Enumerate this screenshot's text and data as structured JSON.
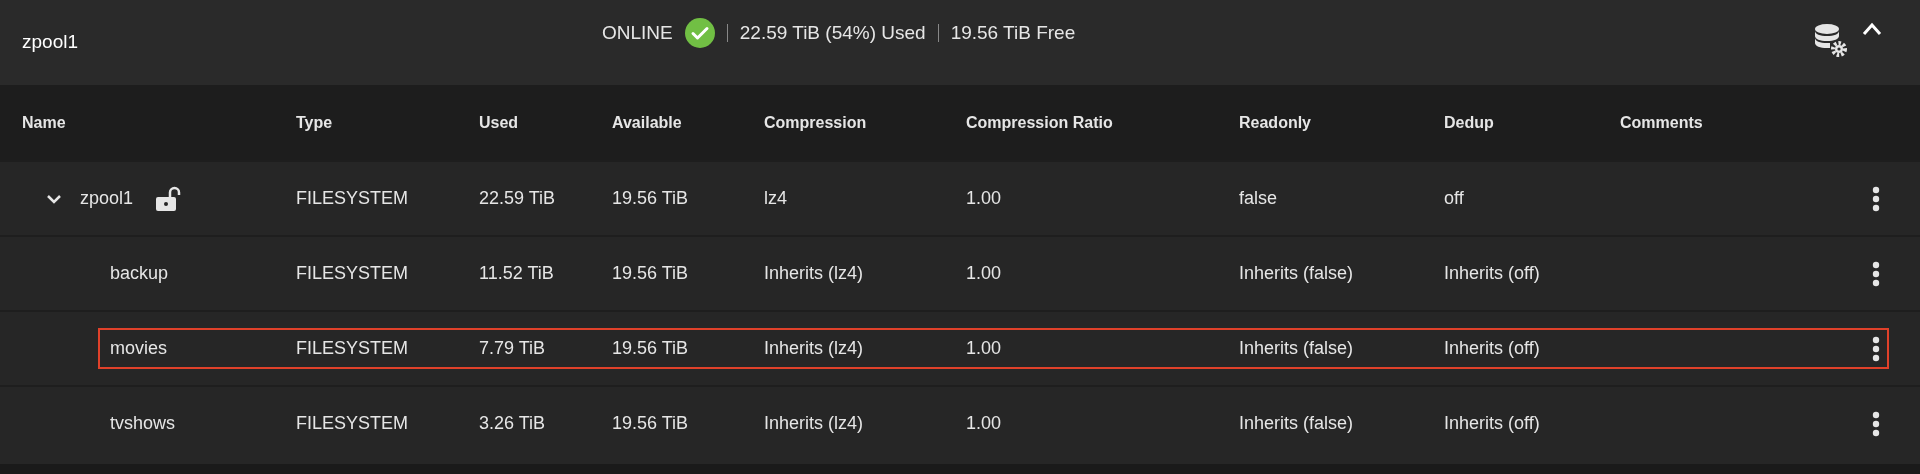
{
  "pool": {
    "name": "zpool1",
    "status": "ONLINE",
    "healthy": true,
    "used": "22.59 TiB (54%) Used",
    "free": "19.56 TiB Free",
    "expanded": true
  },
  "table": {
    "columns": [
      "Name",
      "Type",
      "Used",
      "Available",
      "Compression",
      "Compression Ratio",
      "Readonly",
      "Dedup",
      "Comments"
    ],
    "rows": [
      {
        "name": "zpool1",
        "expanded": true,
        "locked": false,
        "selected": false,
        "type": "FILESYSTEM",
        "used": "22.59 TiB",
        "available": "19.56 TiB",
        "compression": "lz4",
        "ratio": "1.00",
        "readonly": "false",
        "dedup": "off",
        "children": [
          {
            "name": "backup",
            "selected": false,
            "type": "FILESYSTEM",
            "used": "11.52 TiB",
            "available": "19.56 TiB",
            "compression": "Inherits (lz4)",
            "ratio": "1.00",
            "readonly": "Inherits (false)",
            "dedup": "Inherits (off)"
          },
          {
            "name": "movies",
            "selected": true,
            "type": "FILESYSTEM",
            "used": "7.79 TiB",
            "available": "19.56 TiB",
            "compression": "Inherits (lz4)",
            "ratio": "1.00",
            "readonly": "Inherits (false)",
            "dedup": "Inherits (off)"
          },
          {
            "name": "tvshows",
            "selected": false,
            "type": "FILESYSTEM",
            "used": "3.26 TiB",
            "available": "19.56 TiB",
            "compression": "Inherits (lz4)",
            "ratio": "1.00",
            "readonly": "Inherits (false)",
            "dedup": "Inherits (off)"
          }
        ]
      }
    ]
  }
}
